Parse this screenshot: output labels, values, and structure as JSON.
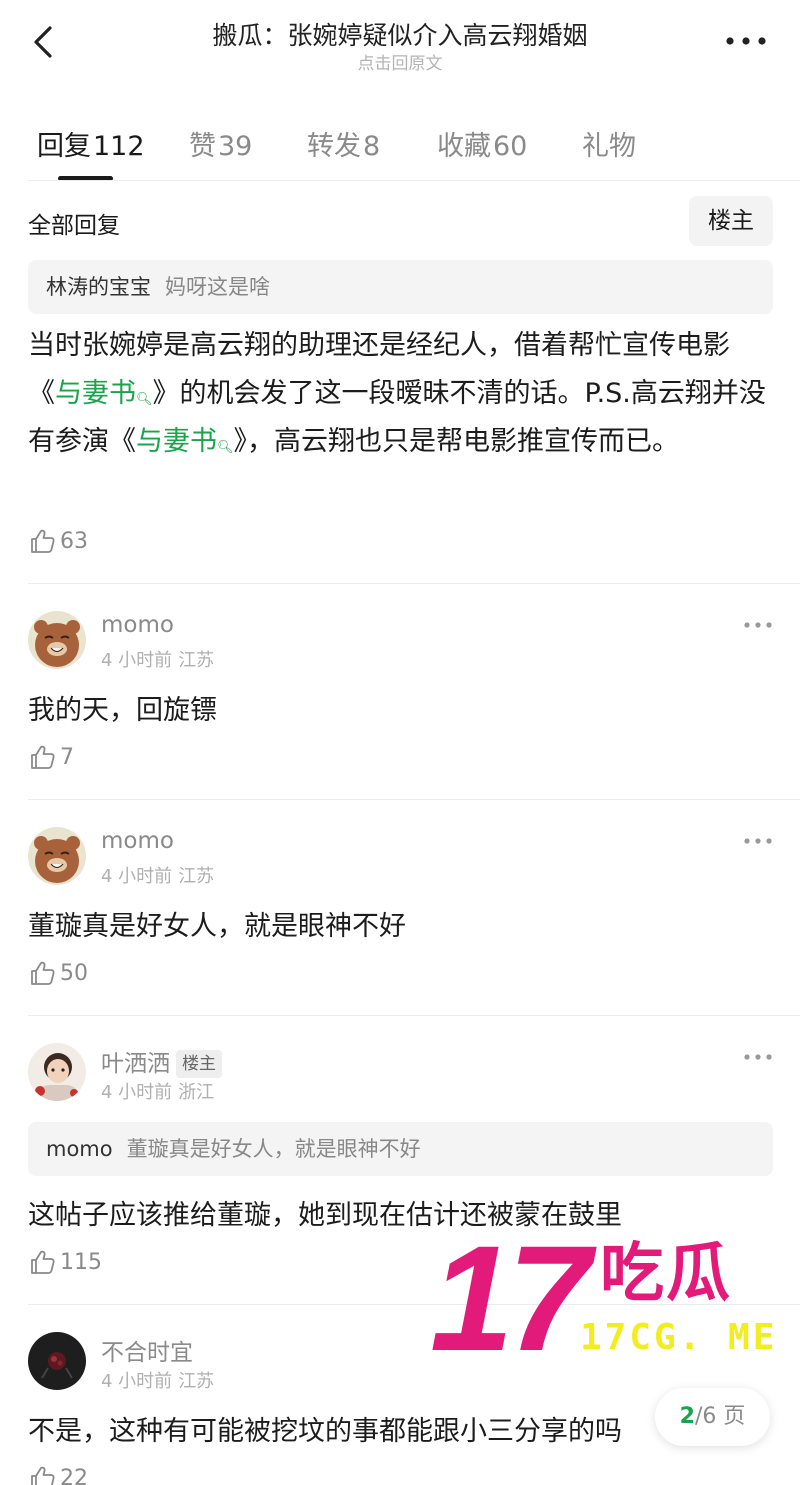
{
  "header": {
    "title": "搬瓜：张婉婷疑似介入高云翔婚姻",
    "subtitle": "点击回原文"
  },
  "tabs": [
    {
      "label": "回复",
      "count": "112"
    },
    {
      "label": "赞",
      "count": "39"
    },
    {
      "label": "转发",
      "count": "8"
    },
    {
      "label": "收藏",
      "count": "60"
    },
    {
      "label": "礼物",
      "count": ""
    }
  ],
  "filter": {
    "label": "全部回复",
    "host_only_button": "楼主"
  },
  "main_reply": {
    "quote_name": "林涛的宝宝",
    "quote_text": "妈呀这是啥",
    "body_part1": "当时张婉婷是高云翔的助理还是经纪人，借着帮忙宣传电影《",
    "topic1": "与妻书",
    "body_part2": "》的机会发了这一段暧昧不清的话。P.S.高云翔并没有参演《",
    "topic2": "与妻书",
    "body_part3": "》，高云翔也只是帮电影推宣传而已。",
    "likes": "63"
  },
  "comments": [
    {
      "user": "momo",
      "time": "4 小时前",
      "location": "江苏",
      "text": "我的天，回旋镖",
      "likes": "7"
    },
    {
      "user": "momo",
      "time": "4 小时前",
      "location": "江苏",
      "text": "董璇真是好女人，就是眼神不好",
      "likes": "50"
    },
    {
      "user": "叶洒洒",
      "badge": "楼主",
      "time": "4 小时前",
      "location": "浙江",
      "quote_name": "momo",
      "quote_text": "董璇真是好女人，就是眼神不好",
      "text": "这帖子应该推给董璇，她到现在估计还被蒙在鼓里",
      "likes": "115"
    },
    {
      "user": "不合时宜",
      "time": "4 小时前",
      "location": "江苏",
      "text": "不是，这种有可能被挖坟的事都能跟小三分享的吗",
      "likes": "22"
    }
  ],
  "watermark": {
    "number": "17",
    "name": "吃瓜",
    "site": "17CG. ME"
  },
  "pager": {
    "current": "2",
    "total": "/6 页"
  },
  "colors": {
    "accent_green": "#19a34b",
    "watermark_pink": "#e21b7a",
    "watermark_yellow": "#f1ed1e"
  }
}
